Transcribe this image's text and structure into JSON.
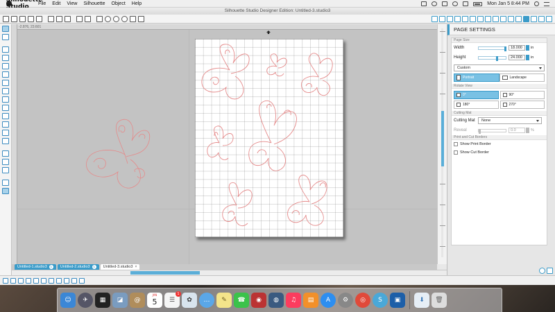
{
  "menubar": {
    "app_name": "Silhouette Studio",
    "items": [
      "File",
      "Edit",
      "View",
      "Silhouette",
      "Object",
      "Help"
    ],
    "clock": "Mon Jan 5  8:44 PM"
  },
  "window": {
    "title": "Silhouette Studio Designer Edition: Untitled-3.studio3"
  },
  "canvas": {
    "coords": "-2.876, 23.601"
  },
  "tabs": [
    {
      "label": "Untitled-1.studio3",
      "badge": "1"
    },
    {
      "label": "Untitled-2.studio3",
      "badge": "1"
    },
    {
      "label": "Untitled-3.studio3",
      "close": "×"
    }
  ],
  "page_settings": {
    "title": "PAGE SETTINGS",
    "page_size": {
      "section": "Page Size",
      "width_label": "Width",
      "width_value": "18.000",
      "height_label": "Height",
      "height_value": "24.000",
      "unit": "in",
      "size_select": "Custom",
      "portrait": "Portrait",
      "landscape": "Landscape"
    },
    "rotate": {
      "section": "Rotate View",
      "r0": "0°",
      "r90": "90°",
      "r180": "180°",
      "r270": "270°"
    },
    "cutting_mat": {
      "section": "Cutting Mat",
      "label": "Cutting Mat",
      "value": "None",
      "reveal_label": "Reveal",
      "reveal_value": "0.0",
      "reveal_unit": "%"
    },
    "borders": {
      "section": "Print and Cut Borders",
      "print_border": "Show Print Border",
      "cut_border": "Show Cut Border"
    }
  },
  "dock": {
    "calendar_month": "JAN",
    "calendar_day": "5",
    "reminders_badge": "1"
  }
}
